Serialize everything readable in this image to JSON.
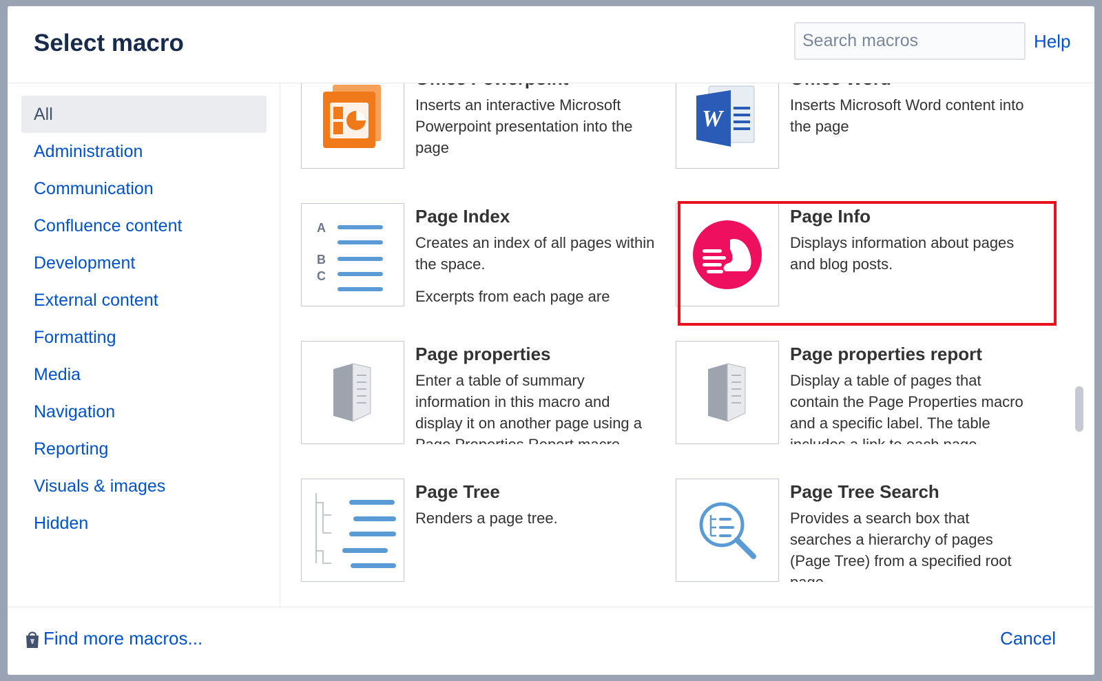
{
  "dialog": {
    "title": "Select macro",
    "search_placeholder": "Search macros",
    "help_label": "Help"
  },
  "sidebar": {
    "items": [
      {
        "label": "All",
        "active": true
      },
      {
        "label": "Administration"
      },
      {
        "label": "Communication"
      },
      {
        "label": "Confluence content"
      },
      {
        "label": "Development"
      },
      {
        "label": "External content"
      },
      {
        "label": "Formatting"
      },
      {
        "label": "Media"
      },
      {
        "label": "Navigation"
      },
      {
        "label": "Reporting"
      },
      {
        "label": "Visuals & images"
      },
      {
        "label": "Hidden"
      }
    ]
  },
  "macros": [
    {
      "name": "Office Powerpoint",
      "description": "Inserts an interactive Microsoft Powerpoint presentation into the page",
      "icon": "powerpoint-icon"
    },
    {
      "name": "Office Word",
      "description": "Inserts Microsoft Word content into the page",
      "icon": "word-icon"
    },
    {
      "name": "Page Index",
      "description": "Creates an index of all pages within the space.",
      "description_extra": "Excerpts from each page are",
      "icon": "page-index-icon"
    },
    {
      "name": "Page Info",
      "description": "Displays information about pages and blog posts.",
      "icon": "page-info-icon",
      "selected": true
    },
    {
      "name": "Page properties",
      "description": "Enter a table of summary information in this macro and display it on another page using a Page Properties Report macro.",
      "icon": "page-properties-icon"
    },
    {
      "name": "Page properties report",
      "description": "Display a table of pages that contain the Page Properties macro and a specific label. The table includes a link to each page",
      "icon": "page-properties-report-icon"
    },
    {
      "name": "Page Tree",
      "description": "Renders a page tree.",
      "icon": "page-tree-icon"
    },
    {
      "name": "Page Tree Search",
      "description": "Provides a search box that searches a hierarchy of pages (Page Tree) from a specified root page.",
      "icon": "page-tree-search-icon"
    }
  ],
  "footer": {
    "find_more_label": "Find more macros...",
    "cancel_label": "Cancel"
  },
  "colors": {
    "link": "#0052cc",
    "title": "#172b4d",
    "highlight": "#e8121b",
    "page_info_icon": "#ee0f5e"
  }
}
